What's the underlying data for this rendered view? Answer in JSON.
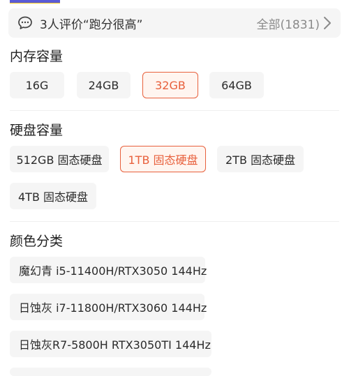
{
  "review": {
    "text": "3人评价“跑分很高”",
    "all": "全部(1831)"
  },
  "memory": {
    "title": "内存容量",
    "options": [
      "16G",
      "24GB",
      "32GB",
      "64GB"
    ],
    "selected": "32GB"
  },
  "storage": {
    "title": "硬盘容量",
    "options": [
      "512GB 固态硬盘",
      "1TB 固态硬盘",
      "2TB 固态硬盘",
      "4TB 固态硬盘"
    ],
    "selected": "1TB 固态硬盘"
  },
  "color": {
    "title": "颜色分类",
    "options": [
      "魔幻青 i5-11400H/RTX3050 144Hz",
      "日蚀灰 i7-11800H/RTX3060 144Hz",
      "日蚀灰R7-5800H RTX3050TI 144Hz"
    ]
  },
  "colors": {
    "accent": "#e8603c",
    "chip_bg": "#f5f5f5",
    "muted_text": "#8a8a8a"
  },
  "icons": {
    "review": "chat-bubble-icon",
    "more": "chevron-right-icon"
  }
}
